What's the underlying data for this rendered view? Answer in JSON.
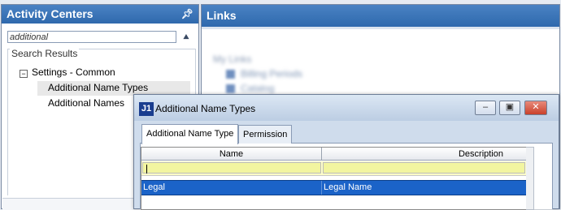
{
  "activity_centers": {
    "title": "Activity Centers",
    "search_value": "additional",
    "results_title": "Search Results",
    "tree": {
      "group_label": "Settings - Common",
      "items": [
        "Additional Name Types",
        "Additional Names"
      ]
    }
  },
  "links": {
    "title": "Links",
    "my_links_label": "My Links",
    "items": [
      "Billing Periods",
      "Catalog"
    ]
  },
  "dialog": {
    "app_icon_text": "J1",
    "title": "Additional Name Types",
    "tabs": [
      "Additional Name Type",
      "Permission"
    ],
    "grid": {
      "columns": [
        "Name",
        "Description"
      ],
      "rows": [
        {
          "name": "Legal",
          "description": "Legal Name"
        }
      ]
    }
  }
}
